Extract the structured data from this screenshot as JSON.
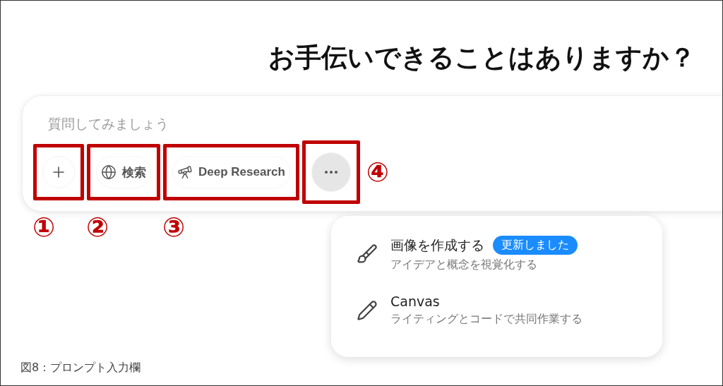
{
  "heading": "お手伝いできることはありますか？",
  "prompt": {
    "placeholder": "質問してみましょう"
  },
  "tools": [
    {
      "kind": "plus",
      "annotation": "①"
    },
    {
      "kind": "search",
      "label": "検索",
      "annotation": "②"
    },
    {
      "kind": "research",
      "label": "Deep Research",
      "annotation": "③"
    },
    {
      "kind": "more",
      "selected": true,
      "annotation": "④"
    }
  ],
  "menu": {
    "items": [
      {
        "kind": "image",
        "title": "画像を作成する",
        "badge": "更新しました",
        "subtitle": "アイデアと概念を視覚化する"
      },
      {
        "kind": "canvas",
        "title": "Canvas",
        "subtitle": "ライティングとコードで共同作業する"
      }
    ]
  },
  "caption": "図8：プロンプト入力欄"
}
